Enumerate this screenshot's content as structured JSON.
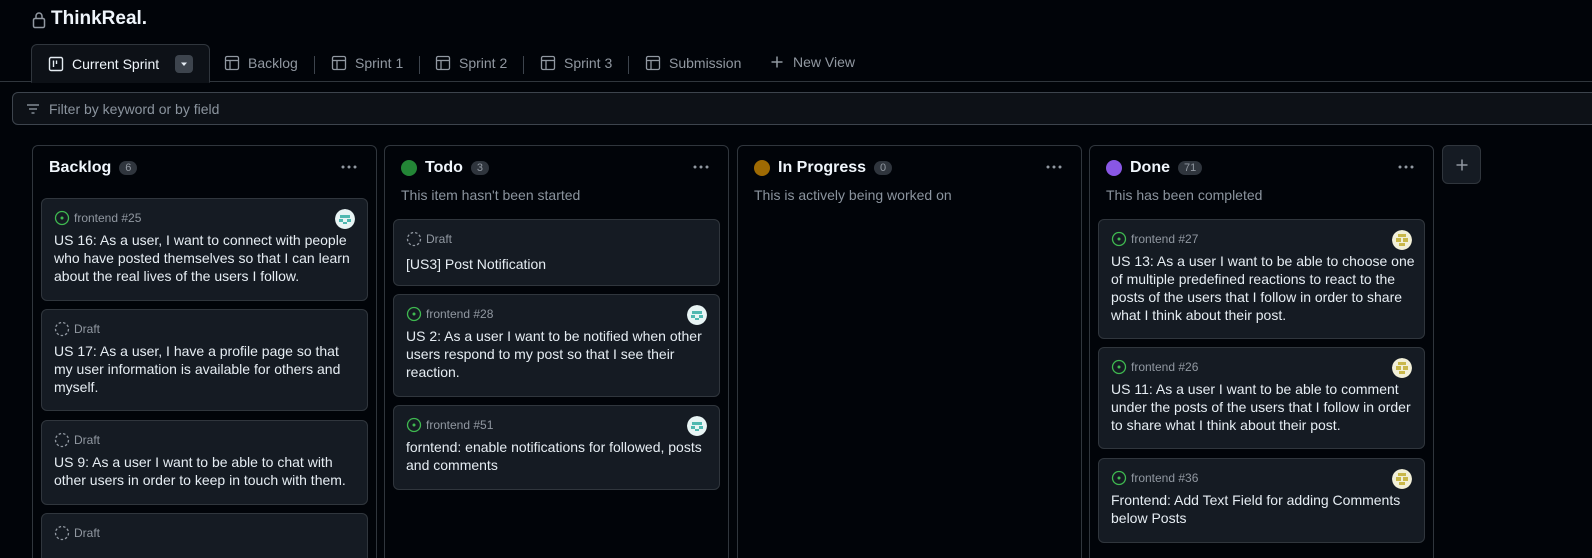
{
  "header": {
    "title": "ThinkReal."
  },
  "tabs": [
    {
      "label": "Current Sprint",
      "icon": "board-icon"
    },
    {
      "label": "Backlog",
      "icon": "table-icon"
    },
    {
      "label": "Sprint 1",
      "icon": "table-icon"
    },
    {
      "label": "Sprint 2",
      "icon": "table-icon"
    },
    {
      "label": "Sprint 3",
      "icon": "table-icon"
    },
    {
      "label": "Submission",
      "icon": "table-icon"
    },
    {
      "label": "New View",
      "icon": "plus-icon"
    }
  ],
  "filter": {
    "placeholder": "Filter by keyword or by field"
  },
  "colors": {
    "todo": "#238636",
    "in_progress": "#9e6a03",
    "done": "#8957e5",
    "open_issue": "#3fb950"
  },
  "columns": [
    {
      "title": "Backlog",
      "count": "6",
      "description": "",
      "cards": [
        {
          "meta": "frontend #25",
          "text": "US 16: As a user, I want to connect with people who have posted themselves so that I can learn about the real lives of the users I follow.",
          "avatar": "teal"
        },
        {
          "meta": "Draft",
          "text": "US 17: As a user, I have a profile page so that my user information is available for others and myself."
        },
        {
          "meta": "Draft",
          "text": "US 9: As a user I want to be able to chat with other users in order to keep in touch with them."
        },
        {
          "meta": "Draft",
          "text": ""
        }
      ]
    },
    {
      "title": "Todo",
      "count": "3",
      "description": "This item hasn't been started",
      "cards": [
        {
          "meta": "Draft",
          "text": "[US3] Post Notification"
        },
        {
          "meta": "frontend #28",
          "text": "US 2: As a user I want to be notified when other users respond to my post so that I see their reaction.",
          "avatar": "teal"
        },
        {
          "meta": "frontend #51",
          "text": "forntend: enable notifications for followed, posts and comments",
          "avatar": "teal"
        }
      ]
    },
    {
      "title": "In Progress",
      "count": "0",
      "description": "This is actively being worked on",
      "cards": []
    },
    {
      "title": "Done",
      "count": "71",
      "description": "This has been completed",
      "cards": [
        {
          "meta": "frontend #27",
          "text": "US 13: As a user I want to be able to choose one of multiple predefined reactions to react to the posts of the users that I follow in order to share what I think about their post.",
          "avatar": "olive"
        },
        {
          "meta": "frontend #26",
          "text": "US 11: As a user I want to be able to comment under the posts of the users that I follow in order to share what I think about their post.",
          "avatar": "olive"
        },
        {
          "meta": "frontend #36",
          "text": "Frontend: Add Text Field for adding Comments below Posts",
          "avatar": "olive"
        }
      ]
    }
  ]
}
